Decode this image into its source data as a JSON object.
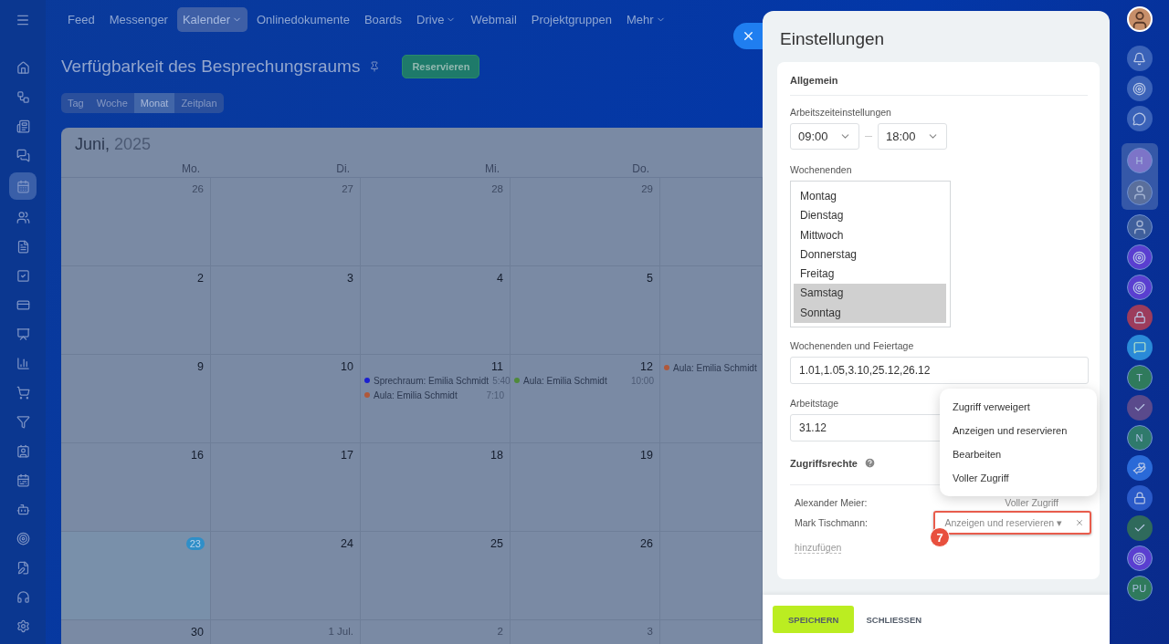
{
  "left_sidebar": {
    "items": [
      {
        "kind": "home",
        "selected": false
      },
      {
        "kind": "flow",
        "selected": false
      },
      {
        "kind": "news",
        "selected": false
      },
      {
        "kind": "chat",
        "selected": false
      },
      {
        "kind": "calendar",
        "selected": true
      },
      {
        "kind": "people",
        "selected": false
      },
      {
        "kind": "doc",
        "selected": false
      },
      {
        "kind": "task",
        "selected": false
      },
      {
        "kind": "card",
        "selected": false
      },
      {
        "kind": "screen",
        "selected": false
      },
      {
        "kind": "chart",
        "selected": false
      },
      {
        "kind": "cart",
        "selected": false
      },
      {
        "kind": "filter",
        "selected": false
      },
      {
        "kind": "contact",
        "selected": false
      },
      {
        "kind": "plan",
        "selected": false
      },
      {
        "kind": "bot",
        "selected": false
      },
      {
        "kind": "target",
        "selected": false
      },
      {
        "kind": "edit",
        "selected": false
      },
      {
        "kind": "support",
        "selected": false
      },
      {
        "kind": "settings",
        "selected": false
      }
    ]
  },
  "top_nav": [
    {
      "label": "Feed",
      "selected": false,
      "dropdown": false
    },
    {
      "label": "Messenger",
      "selected": false,
      "dropdown": false
    },
    {
      "label": "Kalender",
      "selected": true,
      "dropdown": true
    },
    {
      "label": "Onlinedokumente",
      "selected": false,
      "dropdown": false
    },
    {
      "label": "Boards",
      "selected": false,
      "dropdown": false
    },
    {
      "label": "Drive",
      "selected": false,
      "dropdown": true
    },
    {
      "label": "Webmail",
      "selected": false,
      "dropdown": false
    },
    {
      "label": "Projektgruppen",
      "selected": false,
      "dropdown": false
    },
    {
      "label": "Mehr",
      "selected": false,
      "dropdown": true
    }
  ],
  "page_title": "Verfügbarkeit des Besprechungsraums",
  "reserve_button": "Reservieren",
  "view_tabs": [
    {
      "label": "Tag",
      "selected": false
    },
    {
      "label": "Woche",
      "selected": false
    },
    {
      "label": "Monat",
      "selected": true
    },
    {
      "label": "Zeitplan",
      "selected": false
    }
  ],
  "calendar": {
    "month": "Juni,",
    "year": "2025",
    "weekdays": [
      "Mo.",
      "Di.",
      "Mi.",
      "Do."
    ],
    "weeks": [
      [
        {
          "day": "26",
          "muted": true
        },
        {
          "day": "27",
          "muted": true
        },
        {
          "day": "28",
          "muted": true
        },
        {
          "day": "29",
          "muted": true
        }
      ],
      [
        {
          "day": "2",
          "muted": false
        },
        {
          "day": "3",
          "muted": false
        },
        {
          "day": "4",
          "muted": false
        },
        {
          "day": "5",
          "muted": false
        }
      ],
      [
        {
          "day": "9",
          "muted": false
        },
        {
          "day": "10",
          "muted": false
        },
        {
          "day": "11",
          "muted": false,
          "events": [
            {
              "title": "Sprechraum: Emilia Schmidt",
              "time": "5:40",
              "color": "#1a1fd0"
            },
            {
              "title": "Aula: Emilia Schmidt",
              "time": "7:10",
              "color": "#b0583a"
            }
          ]
        },
        {
          "day": "12",
          "muted": false,
          "events": [
            {
              "title": "Aula: Emilia Schmidt",
              "time": "10:00",
              "color": "#4f8a3a"
            }
          ]
        },
        {
          "events": [
            {
              "title": "Aula: Emilia Schmidt",
              "color": "#b0583a"
            }
          ]
        }
      ],
      [
        {
          "day": "16",
          "muted": false
        },
        {
          "day": "17",
          "muted": false
        },
        {
          "day": "18",
          "muted": false
        },
        {
          "day": "19",
          "muted": false
        }
      ],
      [
        {
          "day": "23",
          "today": true
        },
        {
          "day": "24",
          "muted": false
        },
        {
          "day": "25",
          "muted": false
        },
        {
          "day": "26",
          "muted": false
        }
      ],
      [
        {
          "day": "30",
          "muted": false
        },
        {
          "day": "1 Jul.",
          "muted": true
        },
        {
          "day": "2",
          "muted": true
        },
        {
          "day": "3",
          "muted": true
        }
      ]
    ]
  },
  "panel": {
    "title": "Einstellungen",
    "section": "Allgemein",
    "work_hours": {
      "label": "Arbeitszeiteinstellungen",
      "from": "09:00",
      "to": "18:00"
    },
    "weekends": {
      "label": "Wochenenden",
      "days": [
        {
          "label": "Montag",
          "selected": false
        },
        {
          "label": "Dienstag",
          "selected": false
        },
        {
          "label": "Mittwoch",
          "selected": false
        },
        {
          "label": "Donnerstag",
          "selected": false
        },
        {
          "label": "Freitag",
          "selected": false
        },
        {
          "label": "Samstag",
          "selected": true
        },
        {
          "label": "Sonntag",
          "selected": true
        }
      ]
    },
    "holidays": {
      "label": "Wochenenden und Feiertage",
      "value": "1.01,1.05,3.10,25.12,26.12"
    },
    "workdays": {
      "label": "Arbeitstage",
      "value": "31.12"
    },
    "access": {
      "title": "Zugriffsrechte",
      "entries": [
        {
          "name": "Alexander Meier:",
          "value": "Voller Zugriff",
          "editing": false
        },
        {
          "name": "Mark Tischmann:",
          "value": "Anzeigen und reservieren",
          "editing": true,
          "caret": "▾"
        }
      ],
      "add_link": "hinzufügen",
      "menu": [
        "Zugriff verweigert",
        "Anzeigen und reservieren",
        "Bearbeiten",
        "Voller Zugriff"
      ],
      "step_badge": "7"
    },
    "buttons": [
      {
        "label": "SPEICHERN",
        "kind": "primary"
      },
      {
        "label": "SCHLIESSEN",
        "kind": "plain"
      }
    ]
  },
  "right_bar": {
    "items": [
      {
        "kind": "bell"
      },
      {
        "kind": "target"
      },
      {
        "kind": "chat"
      },
      {
        "kind": "letter",
        "text": "H",
        "color": "#7d74c8",
        "grouped": true
      },
      {
        "kind": "avatar",
        "grouped": true
      },
      {
        "kind": "avatar",
        "grouped": false
      },
      {
        "kind": "target",
        "color": "#5a3fd0"
      },
      {
        "kind": "target",
        "color": "#5a3fd0"
      },
      {
        "kind": "lock",
        "color": "#9c3c5c"
      },
      {
        "kind": "message",
        "color": "#2a8ad8"
      },
      {
        "kind": "letter",
        "text": "T",
        "color": "#2f7a5c"
      },
      {
        "kind": "check",
        "color": "#5a4a8c"
      },
      {
        "kind": "letter",
        "text": "N",
        "color": "#2f7a6c"
      },
      {
        "kind": "group",
        "color": "#2a6ad8"
      },
      {
        "kind": "lock",
        "color": "#2a5ac8"
      },
      {
        "kind": "check",
        "color": "#2f6a5c"
      },
      {
        "kind": "target",
        "color": "#5a3fd0"
      },
      {
        "kind": "letter",
        "text": "PU",
        "color": "#2f7a5c"
      }
    ]
  }
}
